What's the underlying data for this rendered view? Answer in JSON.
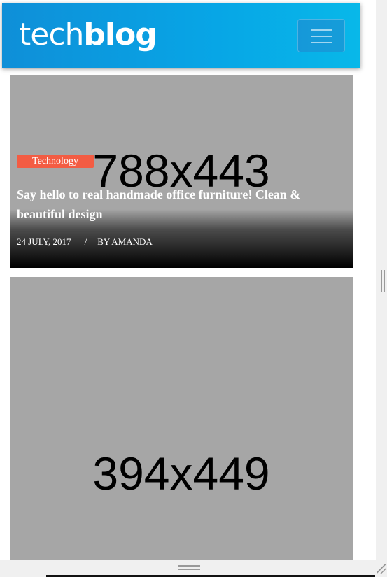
{
  "header": {
    "logo_light": "tech",
    "logo_bold": "blog",
    "menu_icon": "hamburger-icon"
  },
  "posts": [
    {
      "image_placeholder": "788x443",
      "category": "Technology",
      "title": "Say hello to real handmade office furniture! Clean & beautiful design",
      "date": "24 JULY, 2017",
      "separator": "/",
      "author": "BY AMANDA"
    },
    {
      "image_placeholder": "394x449"
    }
  ],
  "colors": {
    "header_gradient_start": "#0f8fd8",
    "header_gradient_end": "#08b8e9",
    "category_badge": "#f35c43",
    "placeholder_bg": "#a6a6a6",
    "text_on_image": "#ffffff"
  }
}
